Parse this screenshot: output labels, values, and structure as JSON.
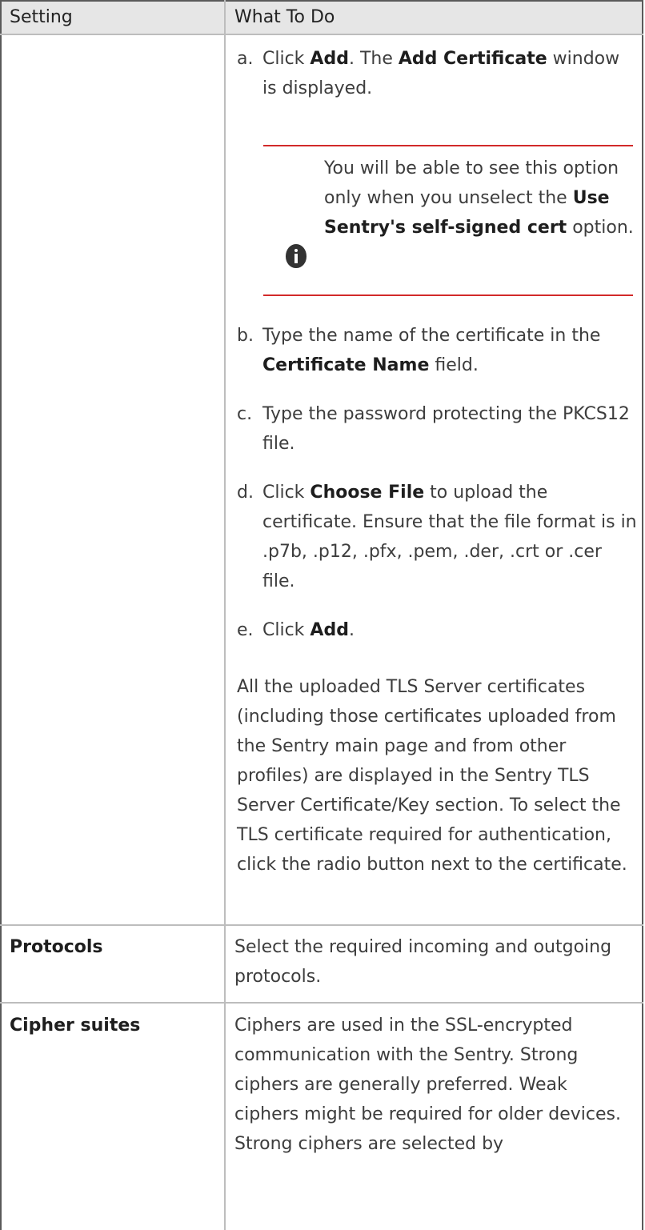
{
  "table": {
    "headers": {
      "setting": "Setting",
      "what_to_do": "What To Do"
    },
    "steps": [
      {
        "letter": "a.",
        "pre": "Click ",
        "b1": "Add",
        "mid": ". The ",
        "b2": "Add Certificate",
        "post": " window is displayed."
      },
      {
        "letter": "b.",
        "pre": "Type the name of the certificate in the ",
        "b1": "Certificate Name",
        "post": " field."
      },
      {
        "letter": "c.",
        "text": "Type the password protecting the PKCS12 file."
      },
      {
        "letter": "d.",
        "pre": "Click ",
        "b1": "Choose File",
        "post": " to upload the certificate. Ensure that the file format is in .p7b, .p12, .pfx, .pem, .der, .crt or .cer file."
      },
      {
        "letter": "e.",
        "pre": "Click ",
        "b1": "Add",
        "post": "."
      }
    ],
    "note": {
      "pre": "You will be able to see this option only when you unselect the ",
      "bold": "Use Sentry's self-signed cert",
      "post": " option."
    },
    "tls_paragraph": "All the uploaded TLS Server certificates (including those certificates uploaded from the Sentry main page and from other profiles) are displayed in the Sentry TLS Server Certificate/Key section. To select the TLS certificate required for authentication, click the radio button next to the certificate.",
    "rows": [
      {
        "setting": "Protocols",
        "what_to_do": "Select the required incoming and outgoing protocols."
      },
      {
        "setting": "Cipher suites",
        "what_to_do": "Ciphers are used in the SSL-encrypted communication with the Sentry. Strong ciphers are generally preferred. Weak ciphers might be required for older devices. Strong ciphers are selected by"
      }
    ]
  }
}
